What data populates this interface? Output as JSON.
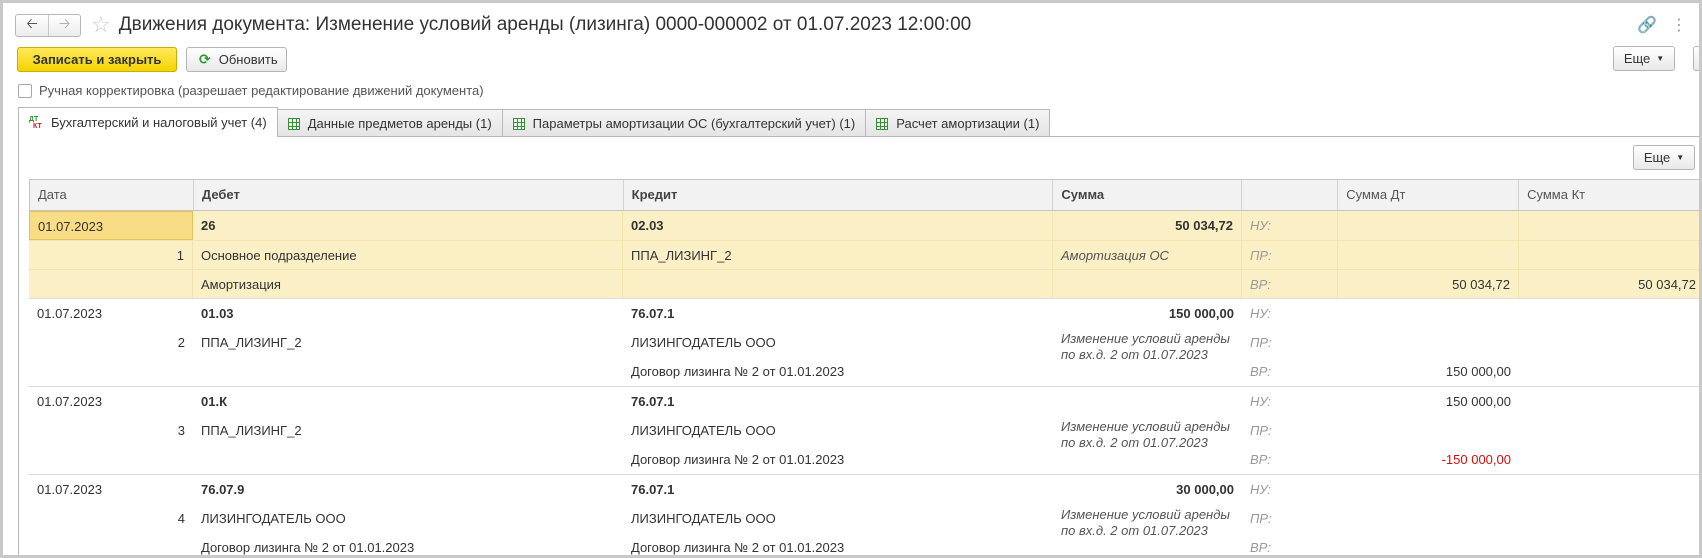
{
  "window": {
    "title": "Движения документа: Изменение условий аренды (лизинга) 0000-000002 от 01.07.2023 12:00:00"
  },
  "toolbar": {
    "save_close": "Записать и закрыть",
    "refresh": "Обновить",
    "more": "Еще"
  },
  "manual_edit": {
    "label": "Ручная корректировка (разрешает редактирование движений документа)",
    "checked": false
  },
  "tabs": [
    {
      "label": "Бухгалтерский и налоговый учет (4)",
      "active": true
    },
    {
      "label": "Данные предметов аренды (1)",
      "active": false
    },
    {
      "label": "Параметры амортизации ОС (бухгалтерский учет) (1)",
      "active": false
    },
    {
      "label": "Расчет амортизации (1)",
      "active": false
    }
  ],
  "table_toolbar": {
    "more": "Еще"
  },
  "table": {
    "headers": {
      "date": "Дата",
      "debit": "Дебет",
      "credit": "Кредит",
      "amount": "Сумма",
      "type": "",
      "amount_dt": "Сумма Дт",
      "amount_kt": "Сумма Кт"
    },
    "rows": [
      {
        "date": "01.07.2023",
        "n": "1",
        "debit": [
          "26",
          "Основное подразделение",
          "Амортизация"
        ],
        "credit": [
          "02.03",
          "ППА_ЛИЗИНГ_2",
          ""
        ],
        "amount": "50 034,72",
        "content": "Амортизация ОС",
        "labels": [
          "НУ:",
          "ПР:",
          "ВР:"
        ],
        "dt": [
          "",
          "",
          "50 034,72"
        ],
        "kt": [
          "",
          "",
          "50 034,72"
        ],
        "selected": true
      },
      {
        "date": "01.07.2023",
        "n": "2",
        "debit": [
          "01.03",
          "ППА_ЛИЗИНГ_2",
          ""
        ],
        "credit": [
          "76.07.1",
          "ЛИЗИНГОДАТЕЛЬ ООО",
          "Договор лизинга № 2 от 01.01.2023"
        ],
        "amount": "150 000,00",
        "content": "Изменение условий аренды по вх.д. 2 от 01.07.2023",
        "labels": [
          "НУ:",
          "ПР:",
          "ВР:"
        ],
        "dt": [
          "",
          "",
          "150 000,00"
        ],
        "kt": [
          "",
          "",
          ""
        ],
        "selected": false
      },
      {
        "date": "01.07.2023",
        "n": "3",
        "debit": [
          "01.К",
          "ППА_ЛИЗИНГ_2",
          ""
        ],
        "credit": [
          "76.07.1",
          "ЛИЗИНГОДАТЕЛЬ ООО",
          "Договор лизинга № 2 от 01.01.2023"
        ],
        "amount": "",
        "content": "Изменение условий аренды по вх.д. 2 от 01.07.2023",
        "labels": [
          "НУ:",
          "ПР:",
          "ВР:"
        ],
        "dt": [
          "150 000,00",
          "",
          "-150 000,00"
        ],
        "kt": [
          "",
          "",
          ""
        ],
        "selected": false
      },
      {
        "date": "01.07.2023",
        "n": "4",
        "debit": [
          "76.07.9",
          "ЛИЗИНГОДАТЕЛЬ ООО",
          "Договор лизинга № 2 от 01.01.2023"
        ],
        "credit": [
          "76.07.1",
          "ЛИЗИНГОДАТЕЛЬ ООО",
          "Договор лизинга № 2 от 01.01.2023"
        ],
        "amount": "30 000,00",
        "content": "Изменение условий аренды по вх.д. 2 от 01.07.2023",
        "labels": [
          "НУ:",
          "ПР:",
          "ВР:"
        ],
        "dt": [
          "",
          "",
          ""
        ],
        "kt": [
          "",
          "",
          ""
        ],
        "selected": false
      }
    ]
  }
}
